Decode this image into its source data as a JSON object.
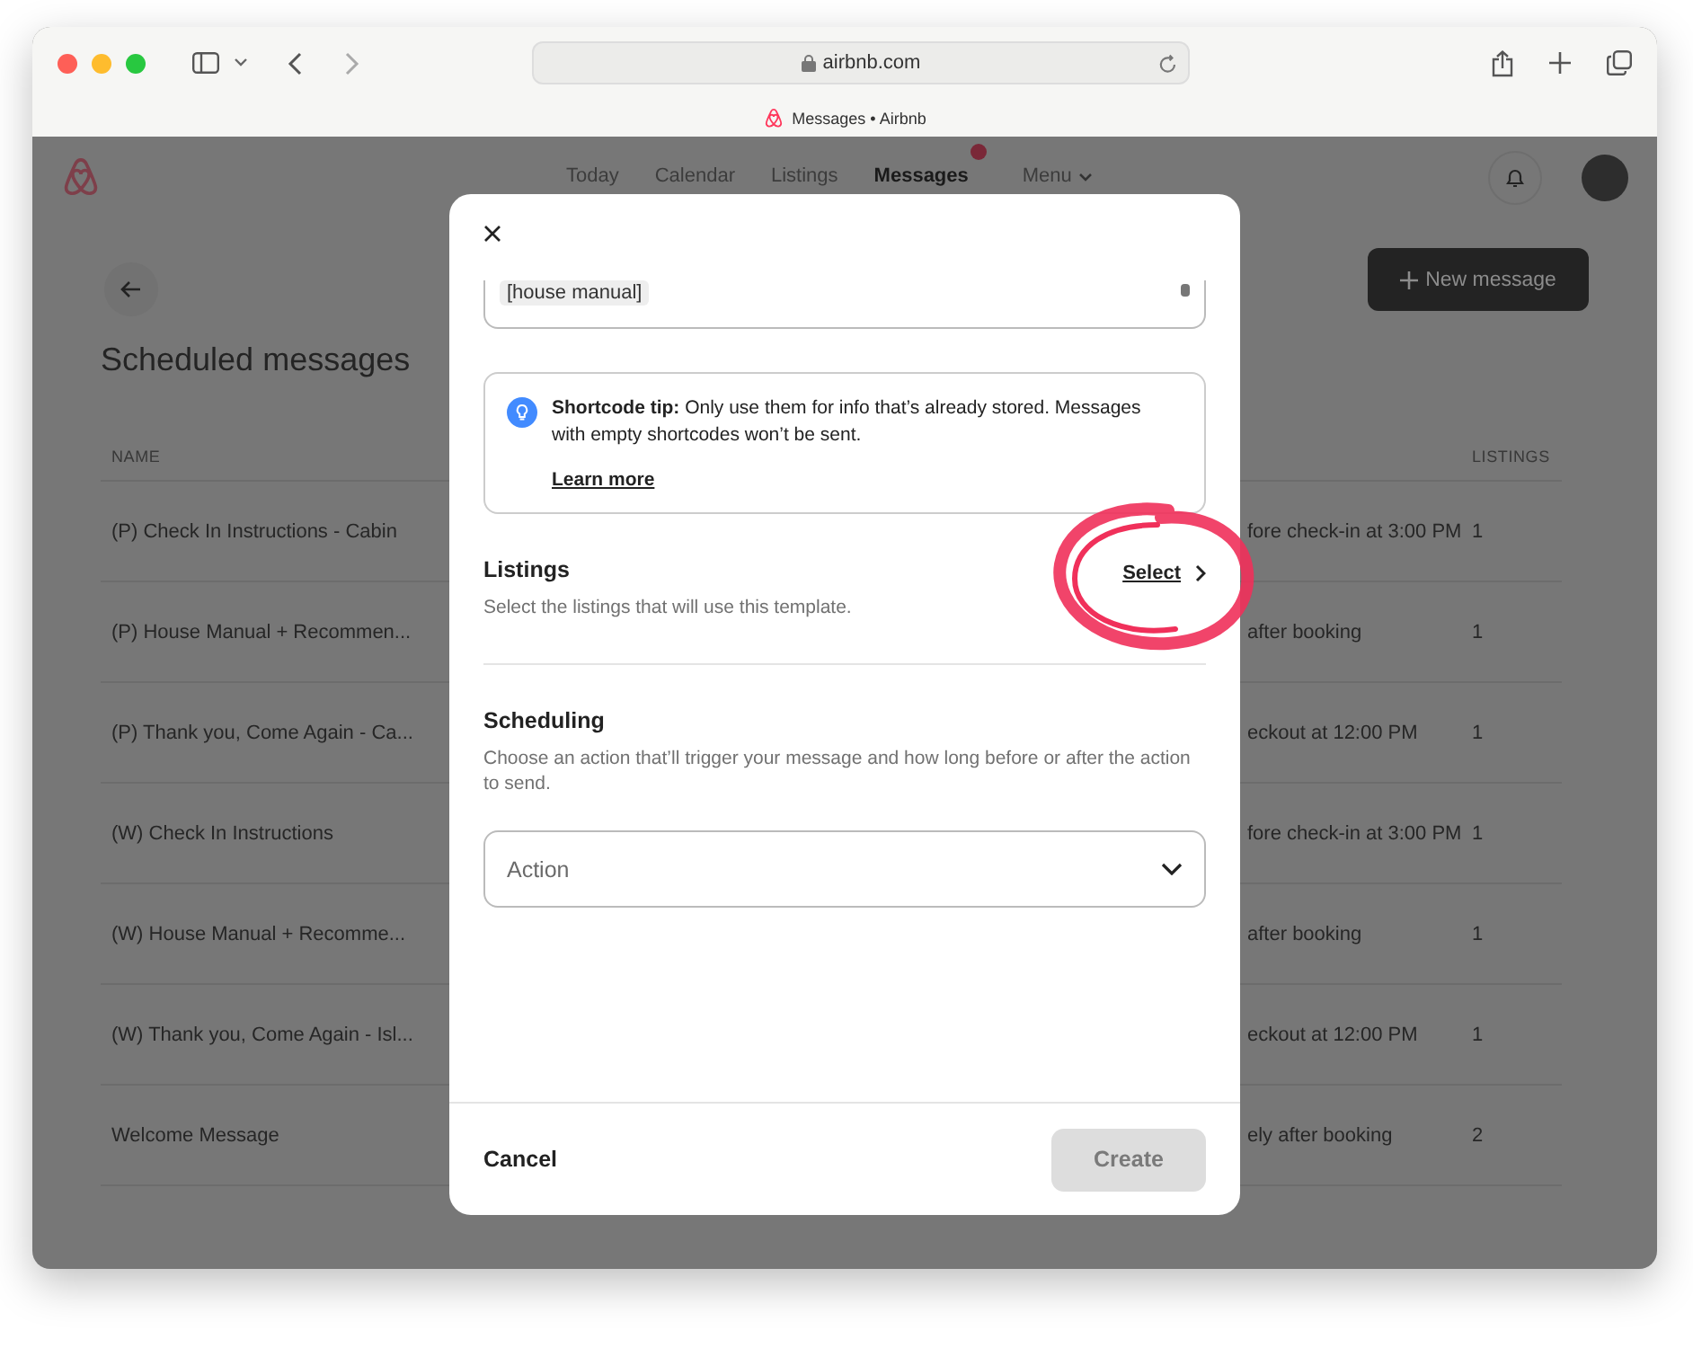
{
  "browser": {
    "url": "airbnb.com",
    "tab_title": "Messages • Airbnb"
  },
  "nav": {
    "tabs": [
      {
        "label": "Today",
        "selected": false,
        "badge": false,
        "dropdown": false
      },
      {
        "label": "Calendar",
        "selected": false,
        "badge": false,
        "dropdown": false
      },
      {
        "label": "Listings",
        "selected": false,
        "badge": false,
        "dropdown": false
      },
      {
        "label": "Messages",
        "selected": true,
        "badge": true,
        "dropdown": false
      },
      {
        "label": "Menu",
        "selected": false,
        "badge": false,
        "dropdown": true
      }
    ]
  },
  "page": {
    "title": "Scheduled messages",
    "new_message_button": "New message",
    "table": {
      "columns": [
        "NAME",
        "LISTINGS"
      ],
      "rows": [
        {
          "name": "(P) Check In Instructions - Cabin",
          "column_2": "fore check-in at 3:00 PM",
          "listings": "1"
        },
        {
          "name": "(P) House Manual + Recommen...",
          "column_2": "after booking",
          "listings": "1"
        },
        {
          "name": "(P) Thank you, Come Again - Ca...",
          "column_2": "eckout at 12:00 PM",
          "listings": "1"
        },
        {
          "name": "(W) Check In Instructions",
          "column_2": "fore check-in at 3:00 PM",
          "listings": "1"
        },
        {
          "name": "(W) House Manual + Recomme...",
          "column_2": "after booking",
          "listings": "1"
        },
        {
          "name": "(W) Thank you, Come Again - Isl...",
          "column_2": "eckout at 12:00 PM",
          "listings": "1"
        },
        {
          "name": "Welcome Message",
          "column_2": "ely after booking",
          "listings": "2"
        }
      ]
    }
  },
  "modal": {
    "shortcode_chip": "[house manual]",
    "tip": {
      "text": "**Shortcode tip:** Only use them for info that’s already stored. Messages with empty shortcodes won’t be sent.",
      "link": "Learn more"
    },
    "listings": {
      "title": "Listings",
      "description": "Select the listings that will use this template.",
      "link": "Select"
    },
    "scheduling": {
      "title": "Scheduling",
      "description": "Choose an action that’ll trigger your message and how long before or after the action to send.",
      "select_placeholder": "Action"
    },
    "cancel_button": "Cancel",
    "create_button": {
      "label": "Create",
      "disabled": true
    }
  }
}
